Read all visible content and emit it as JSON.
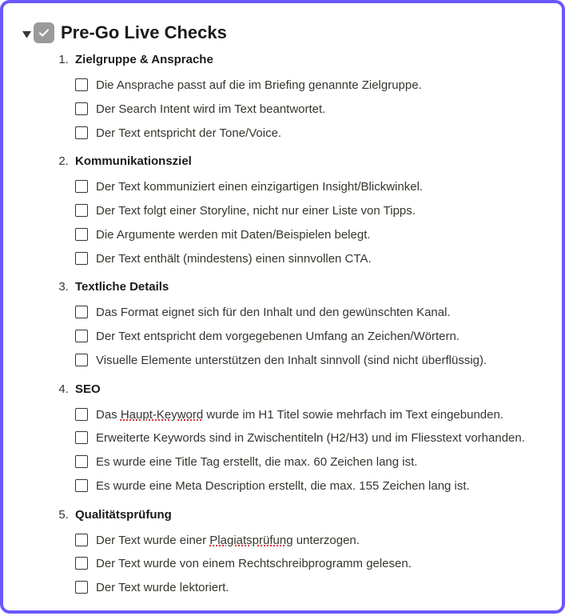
{
  "heading": {
    "title": "Pre-Go Live Checks"
  },
  "sections": [
    {
      "title": "Zielgruppe & Ansprache",
      "items": [
        {
          "label": "Die Ansprache passt auf die im Briefing genannte Zielgruppe.",
          "checked": false
        },
        {
          "label": "Der Search Intent wird im Text beantwortet.",
          "checked": false
        },
        {
          "label": "Der Text entspricht der Tone/Voice.",
          "checked": false
        }
      ]
    },
    {
      "title": "Kommunikationsziel",
      "items": [
        {
          "label": "Der Text kommuniziert einen einzigartigen Insight/Blickwinkel.",
          "checked": false
        },
        {
          "label": "Der Text folgt einer Storyline, nicht nur einer Liste von Tipps.",
          "checked": false
        },
        {
          "label": "Die Argumente werden mit Daten/Beispielen belegt.",
          "checked": false
        },
        {
          "label": "Der Text enthält (mindestens) einen sinnvollen CTA.",
          "checked": false
        }
      ]
    },
    {
      "title": "Textliche Details",
      "items": [
        {
          "label": "Das Format eignet sich für den Inhalt und den gewünschten Kanal.",
          "checked": false
        },
        {
          "label": "Der Text entspricht dem vorgegebenen Umfang an Zeichen/Wörtern.",
          "checked": false
        },
        {
          "label": "Visuelle Elemente unterstützen den Inhalt sinnvoll (sind nicht überflüssig).",
          "checked": false
        }
      ]
    },
    {
      "title": "SEO",
      "items": [
        {
          "label_html": "Das <span class='spell'>Haupt-Keyword</span> wurde im H1 Titel sowie mehrfach im Text eingebunden.",
          "checked": false
        },
        {
          "label": "Erweiterte Keywords sind in Zwischentiteln (H2/H3) und im Fliesstext vorhanden.",
          "checked": false
        },
        {
          "label": "Es wurde eine Title Tag erstellt, die max. 60 Zeichen lang ist.",
          "checked": false
        },
        {
          "label": "Es wurde eine Meta Description erstellt, die max. 155 Zeichen lang ist.",
          "checked": false
        }
      ]
    },
    {
      "title": "Qualitätsprüfung",
      "items": [
        {
          "label_html": "Der Text wurde einer <span class='spell'>Plagiatsprüfung</span> unterzogen.",
          "checked": false
        },
        {
          "label": "Der Text wurde von einem Rechtschreibprogramm gelesen.",
          "checked": false
        },
        {
          "label": "Der Text wurde lektoriert.",
          "checked": false
        }
      ]
    }
  ]
}
